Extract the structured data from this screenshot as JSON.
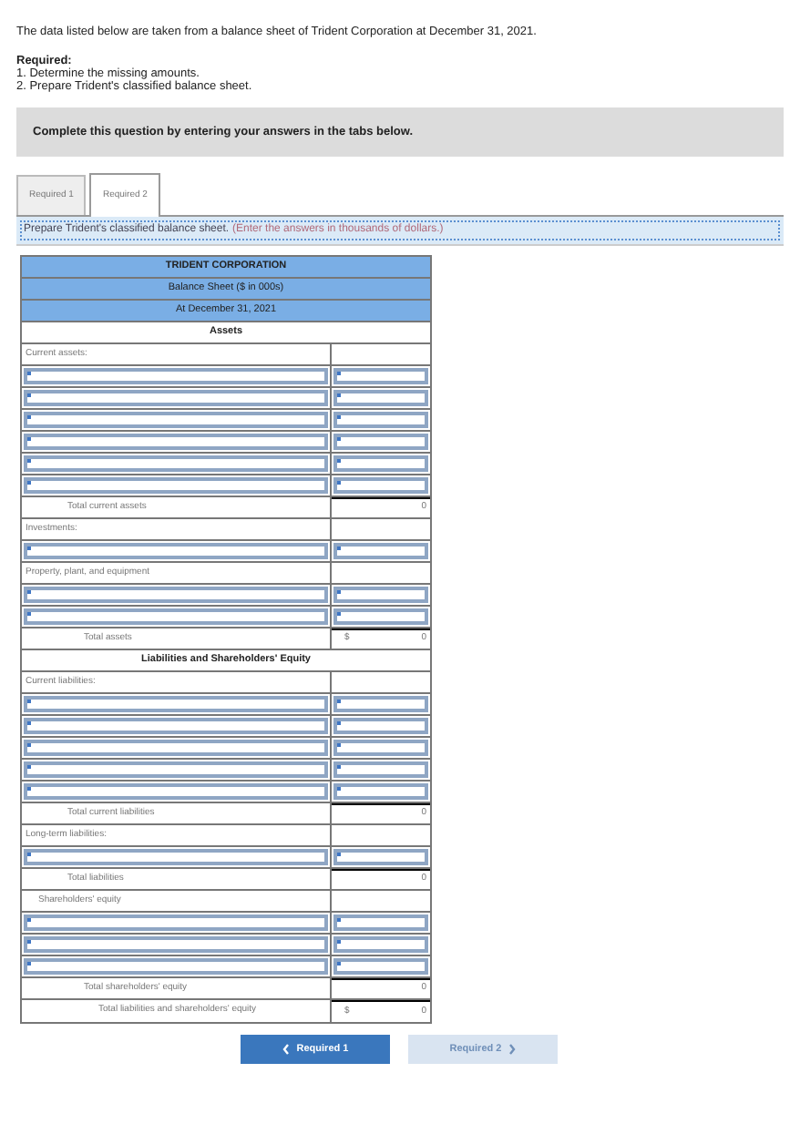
{
  "intro": "The data listed below are taken from a balance sheet of Trident Corporation at December 31, 2021.",
  "required": {
    "heading": "Required:",
    "items": [
      "1. Determine the missing amounts.",
      "2. Prepare Trident's classified balance sheet."
    ]
  },
  "banner": "Complete this question by entering your answers in the tabs below.",
  "tabs": [
    {
      "label": "Required 1",
      "selected": false
    },
    {
      "label": "Required 2",
      "selected": true
    }
  ],
  "instruction": {
    "text": "Prepare Trident's classified balance sheet.",
    "note": "(Enter the answers in thousands of dollars.)"
  },
  "sheet": {
    "title": [
      "TRIDENT CORPORATION",
      "Balance Sheet ($ in 000s)",
      "At December 31, 2021"
    ],
    "rows": [
      {
        "kind": "heading",
        "label": "Assets"
      },
      {
        "kind": "section",
        "label": "Current assets:"
      },
      {
        "kind": "input"
      },
      {
        "kind": "input"
      },
      {
        "kind": "input"
      },
      {
        "kind": "input"
      },
      {
        "kind": "input"
      },
      {
        "kind": "input"
      },
      {
        "kind": "total",
        "label": "Total current assets",
        "value": "0"
      },
      {
        "kind": "section",
        "label": "Investments:"
      },
      {
        "kind": "input"
      },
      {
        "kind": "section",
        "label": "Property, plant, and equipment"
      },
      {
        "kind": "input"
      },
      {
        "kind": "input"
      },
      {
        "kind": "grand",
        "label": "Total assets",
        "currency": "$",
        "value": "0"
      },
      {
        "kind": "heading",
        "label": "Liabilities and Shareholders' Equity"
      },
      {
        "kind": "section",
        "label": "Current liabilities:"
      },
      {
        "kind": "input"
      },
      {
        "kind": "input"
      },
      {
        "kind": "input"
      },
      {
        "kind": "input"
      },
      {
        "kind": "input"
      },
      {
        "kind": "total",
        "label": "Total current liabilities",
        "value": "0"
      },
      {
        "kind": "section",
        "label": "Long-term liabilities:"
      },
      {
        "kind": "input"
      },
      {
        "kind": "total",
        "label": "Total liabilities",
        "value": "0"
      },
      {
        "kind": "subsection",
        "label": "Shareholders' equity"
      },
      {
        "kind": "input"
      },
      {
        "kind": "input"
      },
      {
        "kind": "input"
      },
      {
        "kind": "grand",
        "label": "Total shareholders' equity",
        "value": "0"
      },
      {
        "kind": "final",
        "label": "Total liabilities and shareholders' equity",
        "currency": "$",
        "value": "0"
      }
    ]
  },
  "nav": [
    {
      "label": "Required 1",
      "kind": "prev",
      "disabled": false
    },
    {
      "label": "Required 2",
      "kind": "next",
      "disabled": true
    }
  ]
}
